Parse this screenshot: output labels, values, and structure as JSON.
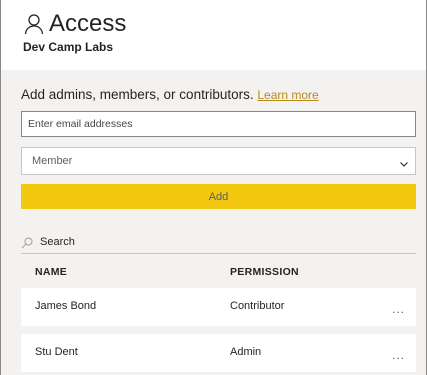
{
  "header": {
    "title": "Access",
    "workspace": "Dev Camp Labs"
  },
  "form": {
    "instruction": "Add admins, members, or contributors.",
    "learn_more": "Learn more",
    "email_placeholder": "Enter email addresses",
    "role_selected": "Member",
    "add_label": "Add"
  },
  "search": {
    "placeholder": "Search"
  },
  "table": {
    "headers": [
      "NAME",
      "PERMISSION"
    ],
    "rows": [
      {
        "name": "James Bond",
        "permission": "Contributor",
        "more": "..."
      },
      {
        "name": "Stu Dent",
        "permission": "Admin",
        "more": "..."
      }
    ]
  },
  "colors": {
    "accent": "#F2C811",
    "link": "#B88A1A",
    "panel_bg": "#F3F2F1"
  }
}
